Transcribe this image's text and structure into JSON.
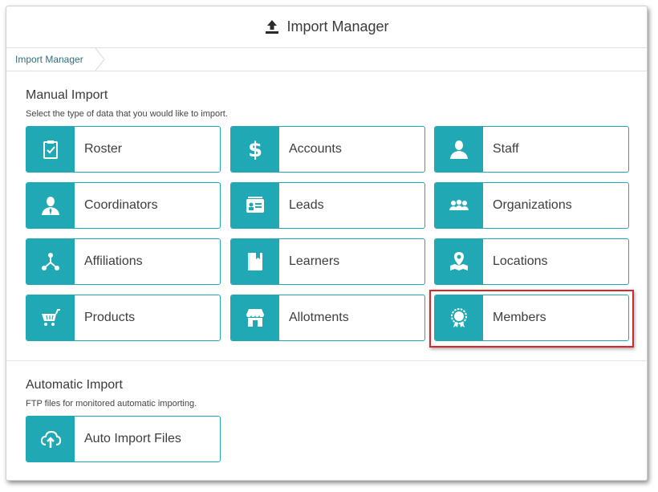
{
  "window": {
    "title": "Import Manager",
    "title_icon": "upload-icon"
  },
  "breadcrumb": {
    "items": [
      "Import Manager"
    ]
  },
  "manual_import": {
    "title": "Manual Import",
    "subtitle": "Select the type of data that you would like to import.",
    "tiles": [
      {
        "label": "Roster",
        "icon": "clipboard-check-icon"
      },
      {
        "label": "Accounts",
        "icon": "dollar-icon"
      },
      {
        "label": "Staff",
        "icon": "person-icon"
      },
      {
        "label": "Coordinators",
        "icon": "person-tie-icon"
      },
      {
        "label": "Leads",
        "icon": "contact-card-icon"
      },
      {
        "label": "Organizations",
        "icon": "group-icon"
      },
      {
        "label": "Affiliations",
        "icon": "network-icon"
      },
      {
        "label": "Learners",
        "icon": "book-icon"
      },
      {
        "label": "Locations",
        "icon": "map-pin-icon"
      },
      {
        "label": "Products",
        "icon": "cart-icon"
      },
      {
        "label": "Allotments",
        "icon": "store-icon"
      },
      {
        "label": "Members",
        "icon": "award-badge-icon"
      }
    ]
  },
  "automatic_import": {
    "title": "Automatic Import",
    "subtitle": "FTP files for monitored automatic importing.",
    "tiles": [
      {
        "label": "Auto Import Files",
        "icon": "cloud-upload-icon"
      }
    ]
  },
  "colors": {
    "accent": "#20a9b4",
    "highlight_border": "#d9262b"
  }
}
